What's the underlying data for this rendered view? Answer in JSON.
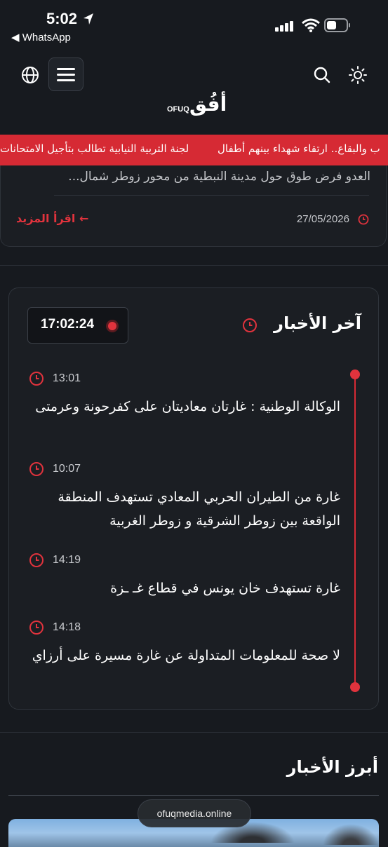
{
  "status_bar": {
    "time": "5:02",
    "back_app": "◀ WhatsApp"
  },
  "logo": {
    "arabic": "أفُق",
    "latin": "OFUQ"
  },
  "ticker": {
    "items": [
      "لجنة التربية النيابية تطالب بتأجيل الامتحانات",
      "ب والبقاع.. ارتقاء شهداء بينهم أطفال"
    ]
  },
  "top_card": {
    "excerpt": "العدو فرض طوق حول مدينة النبطية من محور زوطر شمال...",
    "date": "27/05/2026",
    "read_more": "اقرأ المزيد ←"
  },
  "latest": {
    "title": "آخر الأخبار",
    "live_time": "17:02:24",
    "items": [
      {
        "time": "13:01",
        "text": "الوكالة الوطنية : غارتان معاديتان على كفرحونة وعرمتى"
      },
      {
        "time": "10:07",
        "text": "غارة من الطيران الحربي المعادي تستهدف المنطقة الواقعة بين زوطر الشرقية و زوطر الغربية"
      },
      {
        "time": "14:19",
        "text": "غارة تستهدف خان يونس في قطاع غـ ـزة"
      },
      {
        "time": "14:18",
        "text": "لا صحة للمعلومات المتداولة عن غارة مسيرة على أرزاي"
      }
    ]
  },
  "highlights": {
    "title": "أبرز الأخبار"
  },
  "browser": {
    "url": "ofuqmedia.online"
  },
  "colors": {
    "accent": "#e0333d",
    "background": "#171a1f",
    "card": "#1b1e23"
  }
}
